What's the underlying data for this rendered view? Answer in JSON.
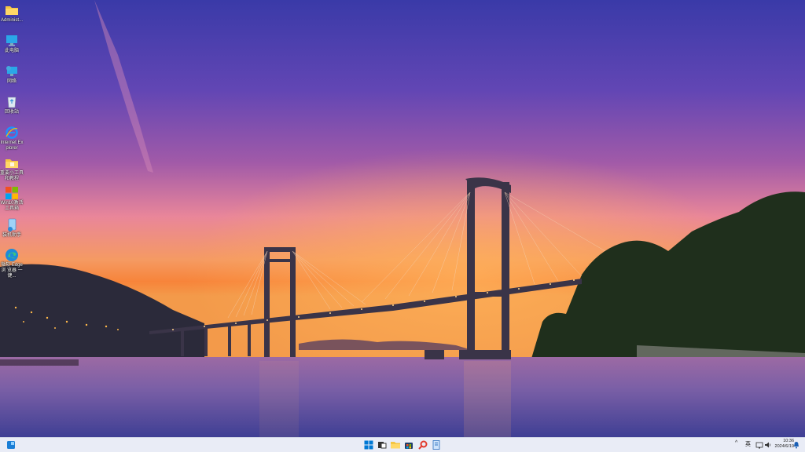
{
  "desktop": {
    "icons": [
      {
        "name": "folder-icon",
        "label": "Administ..."
      },
      {
        "name": "computer-icon",
        "label": "此电脑"
      },
      {
        "name": "network-icon",
        "label": "网络"
      },
      {
        "name": "recycle-bin-icon",
        "label": "回收站"
      },
      {
        "name": "internet-explorer-icon",
        "label": "Internet Explorer"
      },
      {
        "name": "folder-tools-icon",
        "label": "重要小工具 和教程"
      },
      {
        "name": "windows-logo-icon",
        "label": "Win10激活 工具箱"
      },
      {
        "name": "installer-icon",
        "label": "装机助手"
      },
      {
        "name": "edge-icon",
        "label": "微软 Edge浏 览器 一键..."
      }
    ]
  },
  "taskbar": {
    "clock": {
      "time": "10:36",
      "date": "2024/6/19"
    },
    "tray": {
      "chevron": "^",
      "input": "英"
    },
    "colors": {
      "accent": "#0078d4",
      "bar": "#e9ecf6"
    }
  }
}
